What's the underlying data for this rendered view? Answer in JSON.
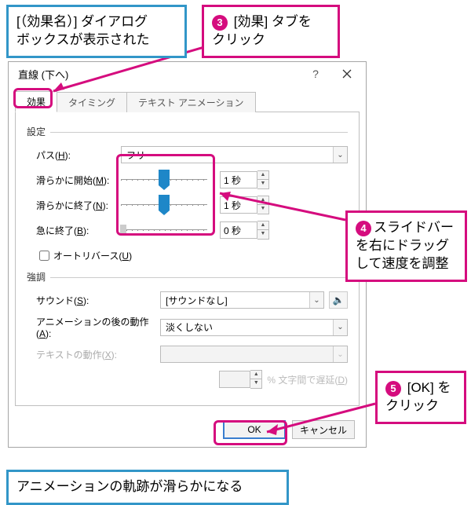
{
  "callout_blue_top": "[（効果名）] ダイアログ\nボックスが表示された",
  "callout_3": {
    "num": "3",
    "text": " [効果] タブを\nクリック"
  },
  "callout_4": {
    "num": "4",
    "text": "スライドバー\nを右にドラッグ\nして速度を調整"
  },
  "callout_5": {
    "num": "5",
    "text": " [OK] を\nクリック"
  },
  "callout_blue_bottom": "アニメーションの軌跡が滑らかになる",
  "dialog": {
    "title": "直線 (下へ)",
    "tabs": {
      "effect": "効果",
      "timing": "タイミング",
      "textanim": "テキスト アニメーション"
    },
    "group_settings": "設定",
    "group_emphasis": "強調",
    "labels": {
      "path": "パス(",
      "path_u": "H",
      "path_after": "):",
      "smooth_start": "滑らかに開始(",
      "smooth_start_u": "M",
      "smooth_start_after": "):",
      "smooth_end": "滑らかに終了(",
      "smooth_end_u": "N",
      "smooth_end_after": "):",
      "sudden_end": "急に終了(",
      "sudden_end_u": "B",
      "sudden_end_after": "):",
      "autoreverse": "オートリバース(",
      "autoreverse_u": "U",
      "autoreverse_after": ")",
      "sound": "サウンド(",
      "sound_u": "S",
      "sound_after": "):",
      "after_anim": "アニメーションの後の動作(",
      "after_anim_u": "A",
      "after_anim_after": "):",
      "text_behave": "テキストの動作(",
      "text_behave_u": "X",
      "text_behave_after": "):",
      "percent_delay": "% 文字間で遅延(",
      "percent_delay_u": "D",
      "percent_delay_after": ")"
    },
    "values": {
      "path": "フリー",
      "smooth_start": "1 秒",
      "smooth_end": "1 秒",
      "sudden_end": "0 秒",
      "sound": "[サウンドなし]",
      "after_anim": "淡くしない"
    },
    "buttons": {
      "ok": "OK",
      "cancel": "キャンセル"
    }
  }
}
